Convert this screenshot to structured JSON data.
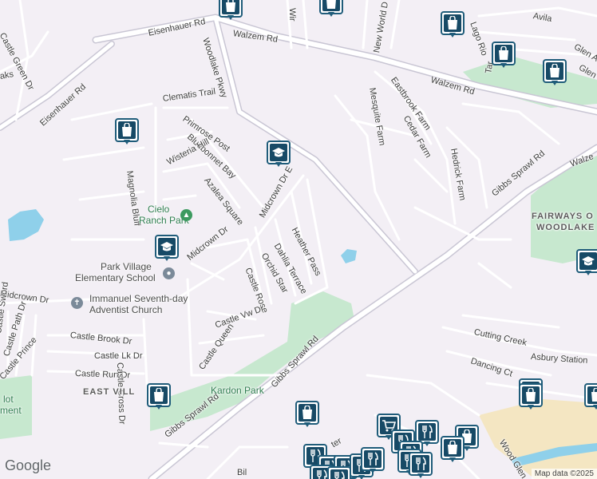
{
  "roads": {
    "eisenhauer_rd_top": "Eisenhauer Rd",
    "eisenhauer_rd_left": "Eisenhauer Rd",
    "walzem_rd_top": "Walzem Rd",
    "walzem_rd_right": "Walzem Rd",
    "walzem_far_right": "Walze",
    "woodlake_pkwy": "Woodlake Pkwy",
    "new_world_dr": "New World D",
    "win": "Wir",
    "lago_rio": "Lago Rio",
    "avila": "Avila",
    "glen_a": "Glen A",
    "glen": "Glen",
    "tar": "Tar",
    "mesquite_farm": "Mesquite Farm",
    "eastbrook_farm": "Eastbrook Farm",
    "cedar_farm": "Cedar Farm",
    "hedrick_farm": "Hedrick Farm",
    "gibbs_sprawl_rd_right": "Gibbs Sprawl Rd",
    "gibbs_sprawl_rd_mid": "Gibbs Sprawl Rd",
    "gibbs_sprawl_rd_low": "Gibbs Sprawl Rd",
    "castle_green_dr": "Castle Green Dr",
    "aks": "aks",
    "clematis_trail": "Clematis Trail",
    "primrose_post": "Primrose Post",
    "bluebonnet_bay": "Bluebonnet Bay",
    "wisteria_hill": "Wisteria Hill",
    "magnolia_bluff": "Magnolia Bluff",
    "azalea_square": "Azalea Square",
    "midcrown_dr_e": "Midcrown Dr E",
    "heather_pass": "Heather Pass",
    "dahlia_terrace": "Dahlia Terrace",
    "orchid_star": "Orchid Star",
    "castle_rose": "Castle Rose",
    "midcrown_dr_mid": "Midcrown Dr",
    "midcrown_dr_left": "Midcrown Dr",
    "castle_vw_dr": "Castle Vw Dr",
    "castle_queen": "Castle Queen",
    "castle_sword": "Castle Sword",
    "castle_path_dr": "Castle Path Dr",
    "castle_prince": "Castle Prince",
    "castle_brook_dr": "Castle Brook Dr",
    "castle_lk_dr": "Castle Lk Dr",
    "castle_run_dr": "Castle Run Dr",
    "castle_cross_dr": "Castle Cross Dr",
    "cutting_creek": "Cutting Creek",
    "asbury_station": "Asbury Station",
    "dancing_ct": "Dancing Ct",
    "wood_glen": "Wood Glen",
    "ter": "ter",
    "bil": "Bil"
  },
  "places": {
    "cielo_ranch_park": [
      "Cielo",
      "Ranch Park"
    ],
    "park_village_school": [
      "Park Village",
      "Elementary School"
    ],
    "immanuel_church": [
      "Immanuel Seventh-day",
      "Adventist Church"
    ],
    "kardon_park": "Kardon Park",
    "east_village": "EAST VILL",
    "fairways": [
      "FAIRWAYS O",
      "WOODLAKE"
    ],
    "pilot_left": [
      "lot",
      "ment"
    ]
  },
  "footer": {
    "google": "Google",
    "map_data": "Map data ©2025"
  },
  "colors": {
    "background": "#f3eff5",
    "road": "#ffffff",
    "road_casing": "#c9c6d4",
    "park": "#c7e8cf",
    "water": "#8fd0ea",
    "sand": "#f4e6c2",
    "marker": "#174a66",
    "park_text": "#2e7d4f"
  },
  "markers": [
    {
      "id": "shopping",
      "icon": "shopping-bag-icon"
    },
    {
      "id": "school",
      "icon": "graduation-cap-icon"
    },
    {
      "id": "restaurant",
      "icon": "fork-knife-icon"
    },
    {
      "id": "grocery",
      "icon": "shopping-cart-icon"
    }
  ]
}
